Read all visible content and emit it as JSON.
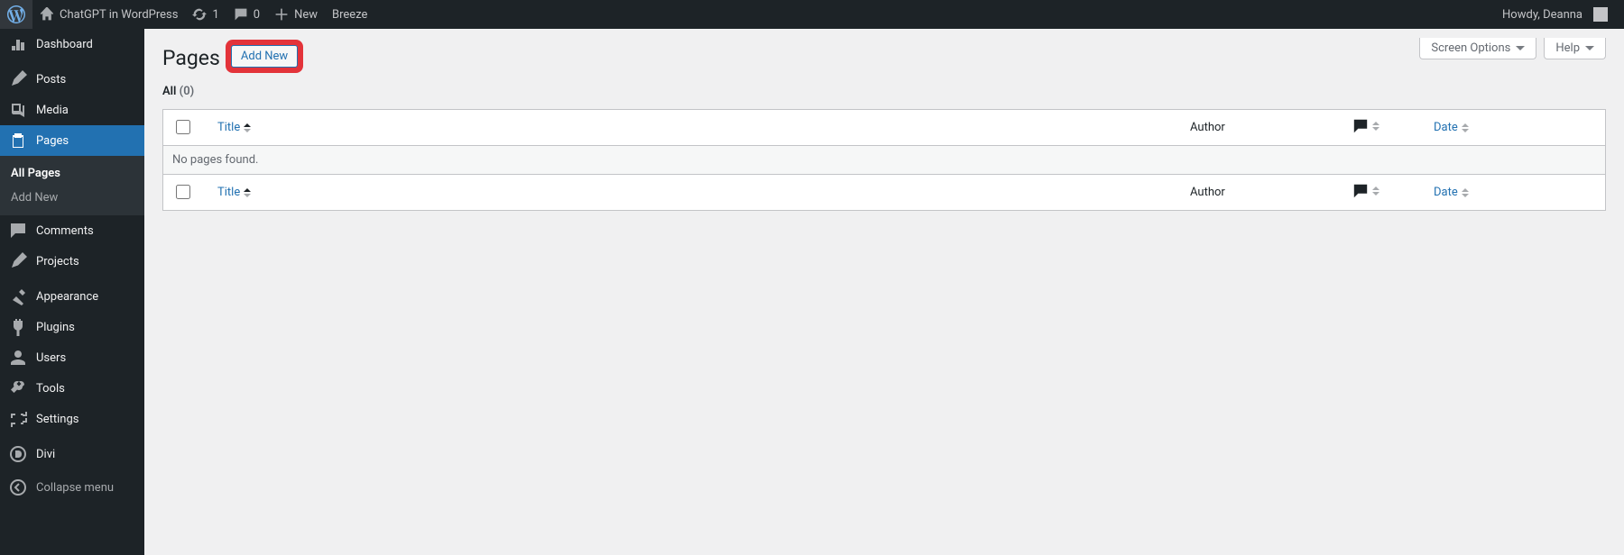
{
  "adminbar": {
    "site_title": "ChatGPT in WordPress",
    "updates_count": "1",
    "comments_count": "0",
    "new_label": "New",
    "breeze_label": "Breeze",
    "howdy": "Howdy, Deanna"
  },
  "menu": {
    "dashboard": "Dashboard",
    "posts": "Posts",
    "media": "Media",
    "pages": "Pages",
    "pages_sub": {
      "all": "All Pages",
      "add": "Add New"
    },
    "comments": "Comments",
    "projects": "Projects",
    "appearance": "Appearance",
    "plugins": "Plugins",
    "users": "Users",
    "tools": "Tools",
    "settings": "Settings",
    "divi": "Divi",
    "collapse": "Collapse menu"
  },
  "screen_meta": {
    "screen_options": "Screen Options",
    "help": "Help"
  },
  "page": {
    "title": "Pages",
    "add_new": "Add New"
  },
  "filters": {
    "all_label": "All",
    "all_count": "(0)"
  },
  "columns": {
    "title": "Title",
    "author": "Author",
    "date": "Date"
  },
  "table": {
    "empty": "No pages found."
  }
}
